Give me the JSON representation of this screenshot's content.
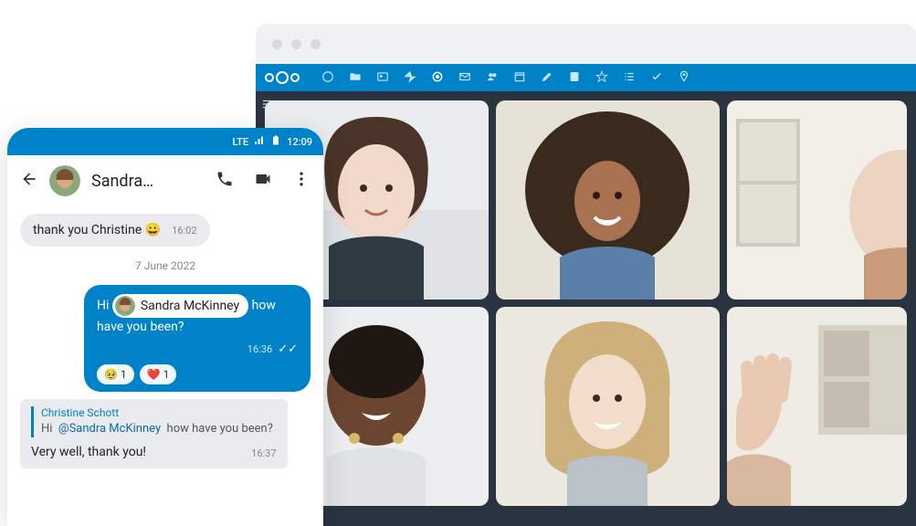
{
  "phone": {
    "status": {
      "network": "LTE",
      "time": "12:09"
    },
    "header": {
      "name": "Sandra…"
    },
    "messages": {
      "m1": {
        "text": "thank you Christine 😀",
        "time": "16:02"
      },
      "date": "7 June 2022",
      "m2": {
        "prefix": "Hi",
        "mention": "Sandra McKinney",
        "suffix": "how have you been?",
        "time": "16:36",
        "r1_count": "1",
        "r2_count": "1",
        "r1_emoji": "🥹",
        "r2_emoji": "❤️"
      },
      "m3": {
        "author": "Christine Schott",
        "quoted": "Hi  @Sandra McKinney  how have you been?",
        "reply": "Very well, thank you!",
        "time": "16:37"
      }
    }
  }
}
